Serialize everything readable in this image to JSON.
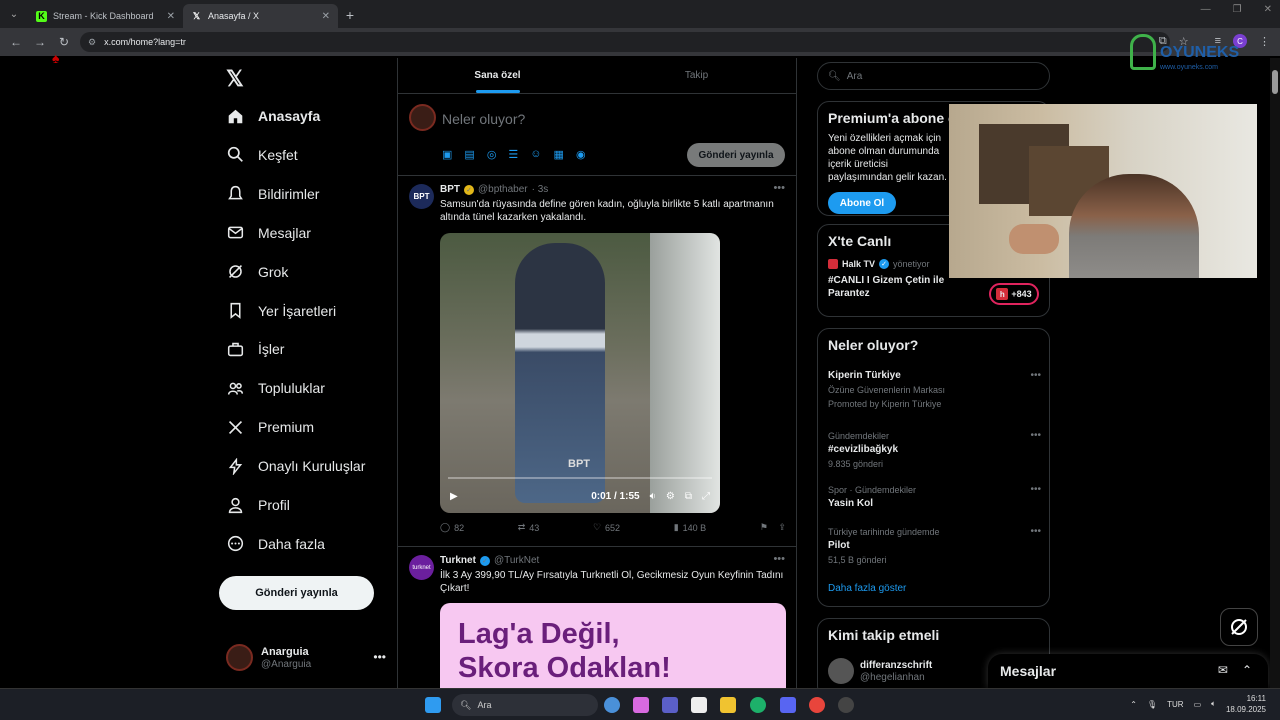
{
  "browser": {
    "tabs": [
      {
        "title": "Stream - Kick Dashboard",
        "favicon": "K"
      },
      {
        "title": "Anasayfa / X",
        "favicon": "𝕏"
      }
    ],
    "url": "x.com/home?lang=tr"
  },
  "nav": {
    "items": [
      {
        "label": "Anasayfa",
        "icon": "home-icon"
      },
      {
        "label": "Keşfet",
        "icon": "search-icon"
      },
      {
        "label": "Bildirimler",
        "icon": "bell-icon"
      },
      {
        "label": "Mesajlar",
        "icon": "envelope-icon"
      },
      {
        "label": "Grok",
        "icon": "grok-icon"
      },
      {
        "label": "Yer İşaretleri",
        "icon": "bookmark-icon"
      },
      {
        "label": "İşler",
        "icon": "briefcase-icon"
      },
      {
        "label": "Topluluklar",
        "icon": "people-icon"
      },
      {
        "label": "Premium",
        "icon": "x-icon"
      },
      {
        "label": "Onaylı Kuruluşlar",
        "icon": "bolt-icon"
      },
      {
        "label": "Profil",
        "icon": "person-icon"
      },
      {
        "label": "Daha fazla",
        "icon": "more-circle-icon"
      }
    ],
    "post_button": "Gönderi yayınla",
    "user": {
      "name": "Anarguia",
      "handle": "@Anarguia"
    }
  },
  "feed": {
    "tabs": [
      "Sana özel",
      "Takip"
    ],
    "composer": {
      "placeholder": "Neler oluyor?",
      "button": "Gönderi yayınla"
    },
    "tweet1": {
      "name": "BPT",
      "handle": "@bpthaber",
      "time": "· 3s",
      "text": "Samsun'da rüyasında define gören kadın, oğluyla birlikte 5 katlı apartmanın altında tünel kazarken yakalandı.",
      "watermark": "BPT",
      "video_time": "0:01 / 1:55",
      "replies": "82",
      "reposts": "43",
      "likes": "652",
      "views": "140 B"
    },
    "tweet2": {
      "name": "Turknet",
      "handle": "@TurkNet",
      "text": "İlk 3 Ay 399,90 TL/Ay Fırsatıyla Turknetli Ol, Gecikmesiz Oyun Keyfinin Tadını Çıkart!",
      "promo_line1": "Lag'a Değil,",
      "promo_line2": "Skora Odaklan!"
    }
  },
  "right": {
    "search_placeholder": "Ara",
    "premium": {
      "title": "Premium'a abone o",
      "text": "Yeni özellikleri açmak için abone olman durumunda içerik üreticisi paylaşımından gelir kazan.",
      "button": "Abone Ol"
    },
    "live": {
      "title": "X'te Canlı",
      "host": "Halk TV",
      "host_suffix": "yönetiyor",
      "stream_title": "#CANLI I Gizem Çetin ile Parantez",
      "count": "+843"
    },
    "trends": {
      "title": "Neler oluyor?",
      "items": [
        {
          "meta": "",
          "name": "Kiperin Türkiye",
          "sub": "Özüne Güvenenlerin Markası",
          "extra": "Promoted by Kiperin Türkiye"
        },
        {
          "meta": "Gündemdekiler",
          "name": "#cevizlibağkyk",
          "sub": "9.835 gönderi",
          "extra": ""
        },
        {
          "meta": "Spor · Gündemdekiler",
          "name": "Yasin Kol",
          "sub": "",
          "extra": ""
        },
        {
          "meta": "Türkiye tarihinde gündemde",
          "name": "Pilot",
          "sub": "51,5 B gönderi",
          "extra": ""
        }
      ],
      "show_more": "Daha fazla göster"
    },
    "who_to_follow": {
      "title": "Kimi takip etmeli",
      "name": "differanzschrift",
      "handle": "@hegelianhan"
    },
    "messages_title": "Mesajlar"
  },
  "overlay": {
    "logo_text": "OYUNEKS",
    "logo_sub": "www.oyuneks.com"
  },
  "taskbar": {
    "search": "Ara",
    "lang": "TUR",
    "time": "16:11",
    "date": "18.09.2025"
  }
}
